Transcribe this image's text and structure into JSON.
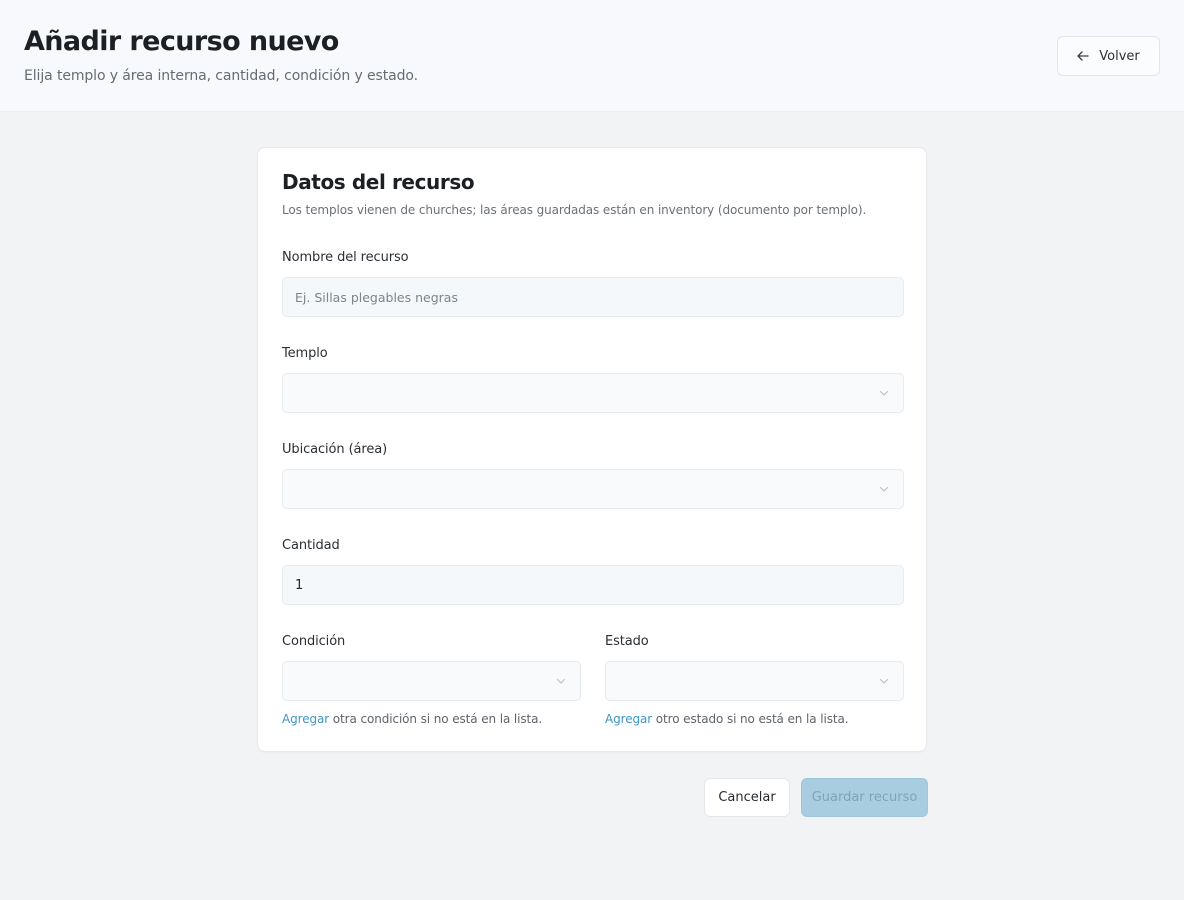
{
  "header": {
    "title": "Añadir recurso nuevo",
    "subtitle": "Elija templo y área interna, cantidad, condición y estado.",
    "back_label": "Volver"
  },
  "card": {
    "title": "Datos del recurso",
    "description": "Los templos vienen de churches; las áreas guardadas están en inventory (documento por templo)."
  },
  "form": {
    "name": {
      "label": "Nombre del recurso",
      "placeholder": "Ej. Sillas plegables negras",
      "value": ""
    },
    "temple": {
      "label": "Templo",
      "value": ""
    },
    "location": {
      "label": "Ubicación (área)",
      "value": ""
    },
    "quantity": {
      "label": "Cantidad",
      "value": "1"
    },
    "condition": {
      "label": "Condición",
      "value": "",
      "help_link": "Agregar",
      "help_text": " otra condición si no está en la lista."
    },
    "status": {
      "label": "Estado",
      "value": "",
      "help_link": "Agregar",
      "help_text": " otro estado si no está en la lista."
    }
  },
  "actions": {
    "cancel_label": "Cancelar",
    "save_label": "Guardar recurso"
  },
  "icons": {
    "back": "arrow-left-icon",
    "dropdown": "chevron-down-icon"
  },
  "colors": {
    "link": "#3f96c9",
    "save_disabled_bg": "#a9cde0",
    "header_bg": "#f7f9fc",
    "page_bg": "#f2f3f5"
  }
}
